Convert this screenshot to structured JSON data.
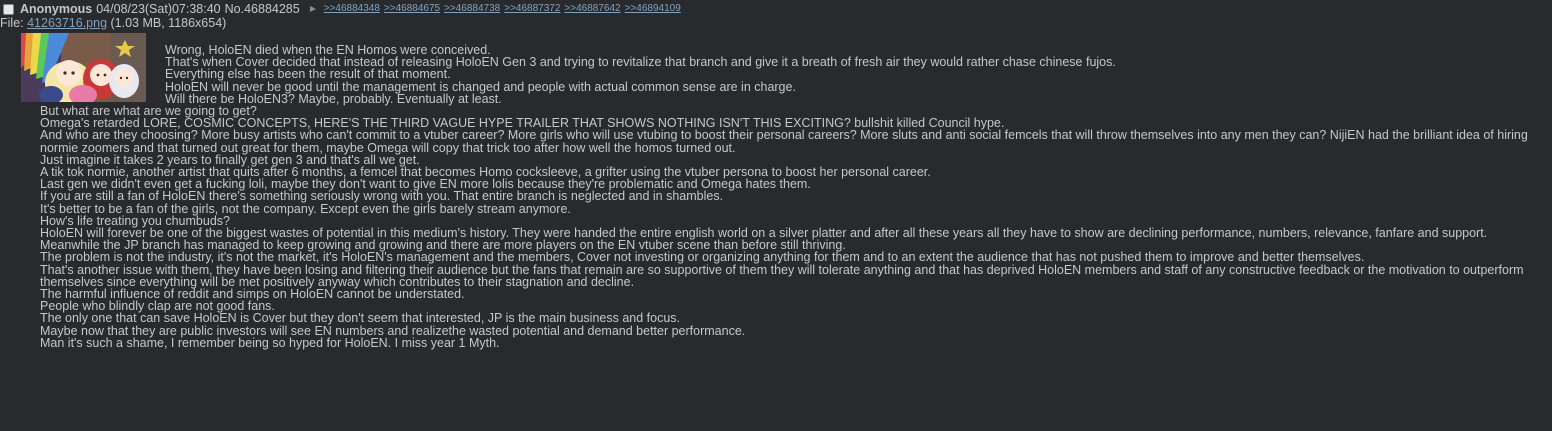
{
  "post": {
    "name": "Anonymous",
    "datetime": "04/08/23(Sat)07:38:40",
    "number": "No.46884285",
    "backlinks": [
      ">>46884348",
      ">>46884675",
      ">>46884738",
      ">>46887372",
      ">>46887642",
      ">>46894109"
    ],
    "file": {
      "prefix": "File: ",
      "filename": "41263716.png",
      "meta": " (1.03 MB, 1186x654)"
    },
    "lines": [
      "Wrong, HoloEN died when the EN Homos were conceived.",
      "That's when Cover decided that instead of releasing HoloEN Gen 3 and trying to revitalize that branch and give it a breath of fresh air they would rather chase chinese fujos.",
      "Everything else has been the result of that moment.",
      "HoloEN will never be good until the management is changed and people with actual common sense are in charge.",
      "Will there be HoloEN3? Maybe, probably. Eventually at least.",
      "But what are what are we going to get?",
      "Omega's retarded LORE, COSMIC CONCEPTS, HERE'S THE THIRD VAGUE HYPE TRAILER THAT SHOWS NOTHING ISN'T THIS EXCITING? bullshit killed Council hype.",
      "And who are they choosing? More busy artists who can't commit to a vtuber career? More girls who will use vtubing to boost their personal careers? More sluts and anti social femcels that will throw themselves into any men they can? NijiEN had the brilliant idea of hiring normie zoomers and that turned out great for them, maybe Omega will copy that trick too after how well the homos turned out.",
      "Just imagine it takes 2 years to finally get gen 3 and that's all we get.",
      "A tik tok normie, another artist that quits after 6 months, a femcel that becomes Homo cocksleeve, a grifter using the vtuber persona to boost her personal career.",
      "Last gen we didn't even get a fucking loli, maybe they don't want to give EN more lolis because they're problematic and Omega hates them.",
      "If you are still a fan of HoloEN there's something seriously wrong with you. That entire branch is neglected and in shambles.",
      "It's better to be a fan of the girls, not the company. Except even the girls barely stream anymore.",
      "How's life treating you chumbuds?",
      "HoloEN will forever be one of the biggest wastes of potential in this medium's history. They were handed the entire english world on a silver platter and after all these years all they have to show are declining performance, numbers, relevance, fanfare and support. Meanwhile the JP branch has managed to keep growing and growing and there are more players on the EN vtuber scene than before still thriving.",
      "The problem is not the industry, it's not the market, it's HoloEN's management and the members, Cover not investing or organizing anything for them and to an extent the audience that has not pushed them to improve and better themselves.",
      "That's another issue with them, they have been losing and filtering their audience but the fans that remain are so supportive of them they will tolerate anything and that has deprived HoloEN members and staff of any constructive feedback or the motivation to outperform themselves since everything will be met positively anyway which contributes to their stagnation and decline.",
      "The harmful influence of reddit and simps on HoloEN cannot be understated.",
      "People who blindly clap are not good fans.",
      "The only one that can save HoloEN is Cover but they don't seem that interested, JP is the main business and focus.",
      "Maybe now that they are public investors will see EN numbers and realizethe wasted potential and demand better performance.",
      "Man it's such a shame, I remember being so hyped for HoloEN. I miss year 1 Myth."
    ]
  }
}
